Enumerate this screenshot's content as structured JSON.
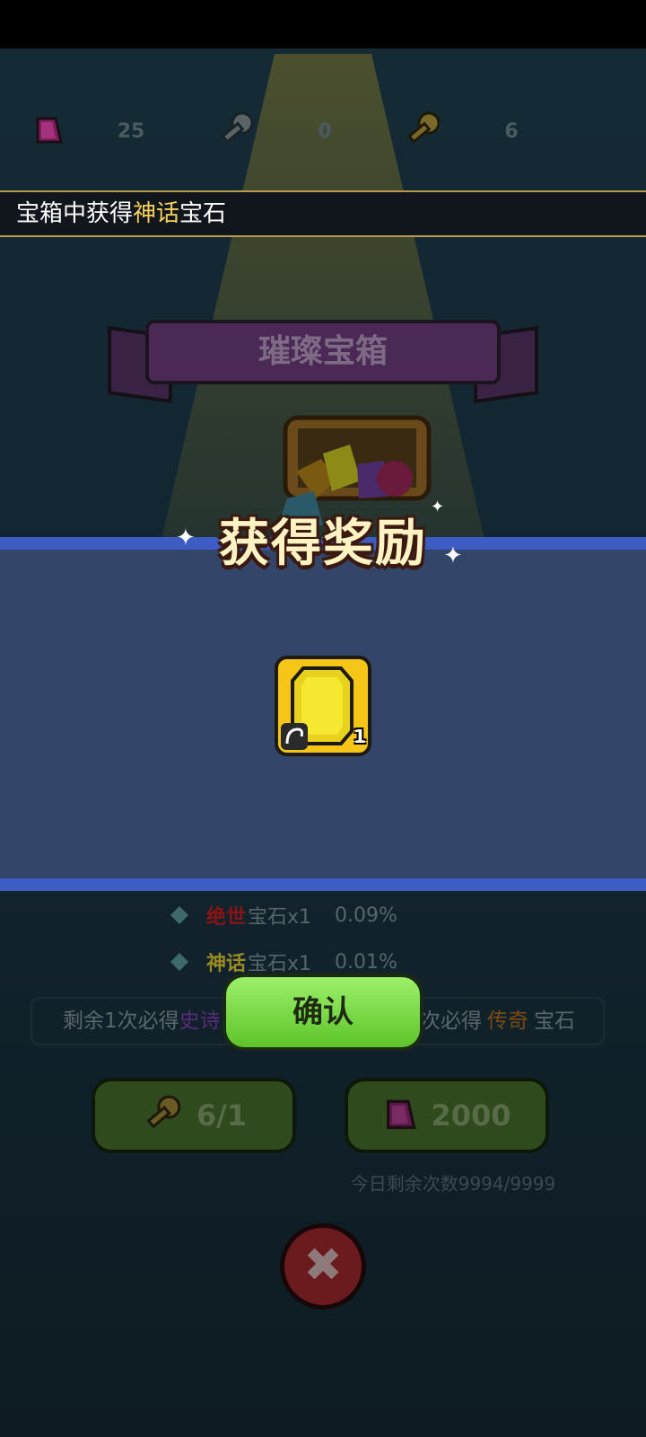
{
  "currencies": [
    {
      "icon": "gem-icon",
      "value": "25"
    },
    {
      "icon": "silver-key-icon",
      "value": "0"
    },
    {
      "icon": "gold-key-icon",
      "value": "6"
    }
  ],
  "ticker": {
    "pre": "宝箱中获得",
    "highlight": "神话",
    "post": "宝石"
  },
  "chest_title": "璀璨宝箱",
  "reward_dialog": {
    "title": "获得奖励",
    "item": {
      "icon": "yellow-gem-icon",
      "count": "1"
    }
  },
  "probabilities": [
    {
      "rarity": "绝世",
      "rarity_color": "#8a1414",
      "item": "宝石x1",
      "rate": "0.09%"
    },
    {
      "rarity": "神话",
      "rarity_color": "#9a8a24",
      "item": "宝石x1",
      "rate": "0.01%"
    }
  ],
  "pity": {
    "left_pre": "剩余1次必得",
    "left_rarity": "史诗",
    "right_pre": "次必得",
    "right_rarity": "传奇",
    "right_post": "宝石"
  },
  "confirm_label": "确认",
  "buy_buttons": [
    {
      "icon": "gold-key-icon",
      "label": "6/1"
    },
    {
      "icon": "gem-icon",
      "label": "2000"
    }
  ],
  "daily_limit": "今日剩余次数9994/9999",
  "colors": {
    "accent": "#3d5dc4",
    "confirm": "#7ee04a"
  }
}
